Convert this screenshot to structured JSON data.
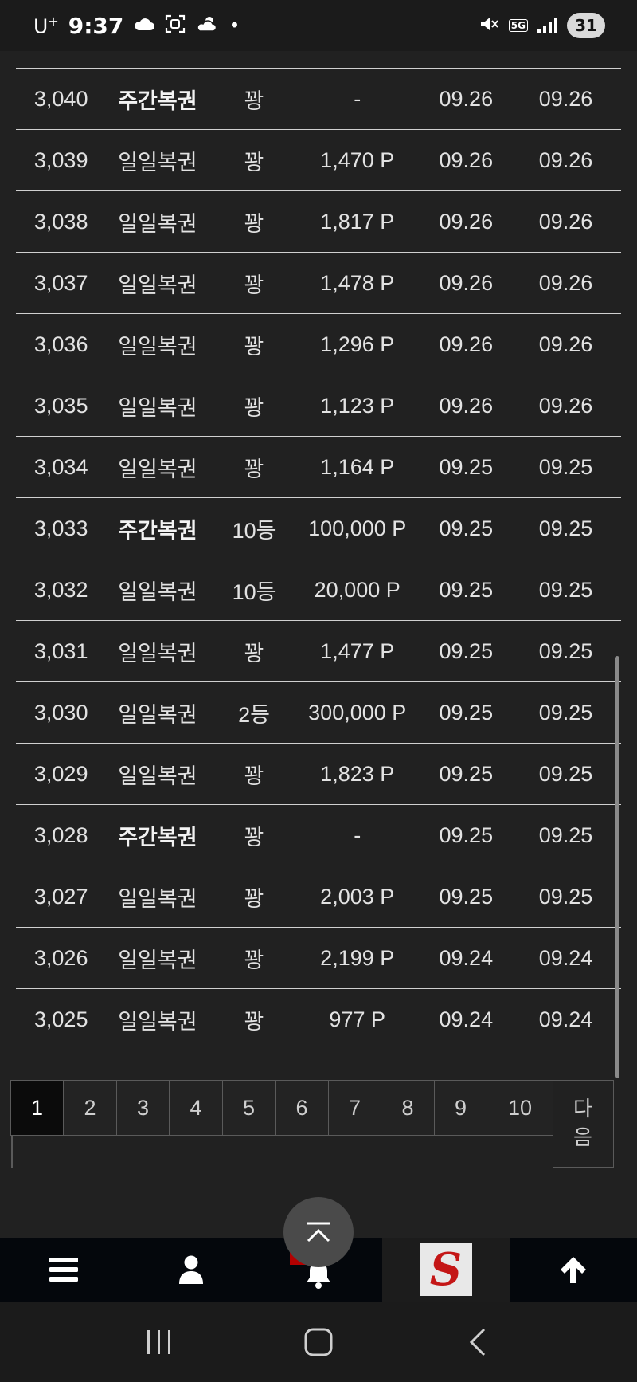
{
  "status_bar": {
    "carrier": "U",
    "carrier_sup": "+",
    "time": "9:37",
    "net_type": "5G",
    "battery": "31",
    "dot": "•"
  },
  "table": {
    "rows": [
      {
        "no": "3,040",
        "type": "주간복권",
        "bold": true,
        "rank": "꽝",
        "prize": "-",
        "date1": "09.26",
        "date2": "09.26"
      },
      {
        "no": "3,039",
        "type": "일일복권",
        "bold": false,
        "rank": "꽝",
        "prize": "1,470 P",
        "date1": "09.26",
        "date2": "09.26"
      },
      {
        "no": "3,038",
        "type": "일일복권",
        "bold": false,
        "rank": "꽝",
        "prize": "1,817 P",
        "date1": "09.26",
        "date2": "09.26"
      },
      {
        "no": "3,037",
        "type": "일일복권",
        "bold": false,
        "rank": "꽝",
        "prize": "1,478 P",
        "date1": "09.26",
        "date2": "09.26"
      },
      {
        "no": "3,036",
        "type": "일일복권",
        "bold": false,
        "rank": "꽝",
        "prize": "1,296 P",
        "date1": "09.26",
        "date2": "09.26"
      },
      {
        "no": "3,035",
        "type": "일일복권",
        "bold": false,
        "rank": "꽝",
        "prize": "1,123 P",
        "date1": "09.26",
        "date2": "09.26"
      },
      {
        "no": "3,034",
        "type": "일일복권",
        "bold": false,
        "rank": "꽝",
        "prize": "1,164 P",
        "date1": "09.25",
        "date2": "09.25"
      },
      {
        "no": "3,033",
        "type": "주간복권",
        "bold": true,
        "rank": "10등",
        "prize": "100,000 P",
        "date1": "09.25",
        "date2": "09.25"
      },
      {
        "no": "3,032",
        "type": "일일복권",
        "bold": false,
        "rank": "10등",
        "prize": "20,000 P",
        "date1": "09.25",
        "date2": "09.25"
      },
      {
        "no": "3,031",
        "type": "일일복권",
        "bold": false,
        "rank": "꽝",
        "prize": "1,477 P",
        "date1": "09.25",
        "date2": "09.25"
      },
      {
        "no": "3,030",
        "type": "일일복권",
        "bold": false,
        "rank": "2등",
        "prize": "300,000 P",
        "date1": "09.25",
        "date2": "09.25"
      },
      {
        "no": "3,029",
        "type": "일일복권",
        "bold": false,
        "rank": "꽝",
        "prize": "1,823 P",
        "date1": "09.25",
        "date2": "09.25"
      },
      {
        "no": "3,028",
        "type": "주간복권",
        "bold": true,
        "rank": "꽝",
        "prize": "-",
        "date1": "09.25",
        "date2": "09.25"
      },
      {
        "no": "3,027",
        "type": "일일복권",
        "bold": false,
        "rank": "꽝",
        "prize": "2,003 P",
        "date1": "09.25",
        "date2": "09.25"
      },
      {
        "no": "3,026",
        "type": "일일복권",
        "bold": false,
        "rank": "꽝",
        "prize": "2,199 P",
        "date1": "09.24",
        "date2": "09.24"
      },
      {
        "no": "3,025",
        "type": "일일복권",
        "bold": false,
        "rank": "꽝",
        "prize": "977 P",
        "date1": "09.24",
        "date2": "09.24"
      }
    ]
  },
  "pagination": {
    "pages": [
      "1",
      "2",
      "3",
      "4",
      "5",
      "6",
      "7",
      "8",
      "9",
      "10"
    ],
    "current": "1",
    "next_label": "다음"
  },
  "bottom_nav": {
    "logo_letter": "S",
    "icons": [
      "menu-icon",
      "user-icon",
      "bell-icon",
      "site-logo",
      "arrow-up-icon"
    ]
  },
  "colors": {
    "background": "#212121",
    "text": "#e4e4e4",
    "nav_background": "#04070c",
    "logo_red": "#c41616",
    "badge_red": "#b30000"
  }
}
